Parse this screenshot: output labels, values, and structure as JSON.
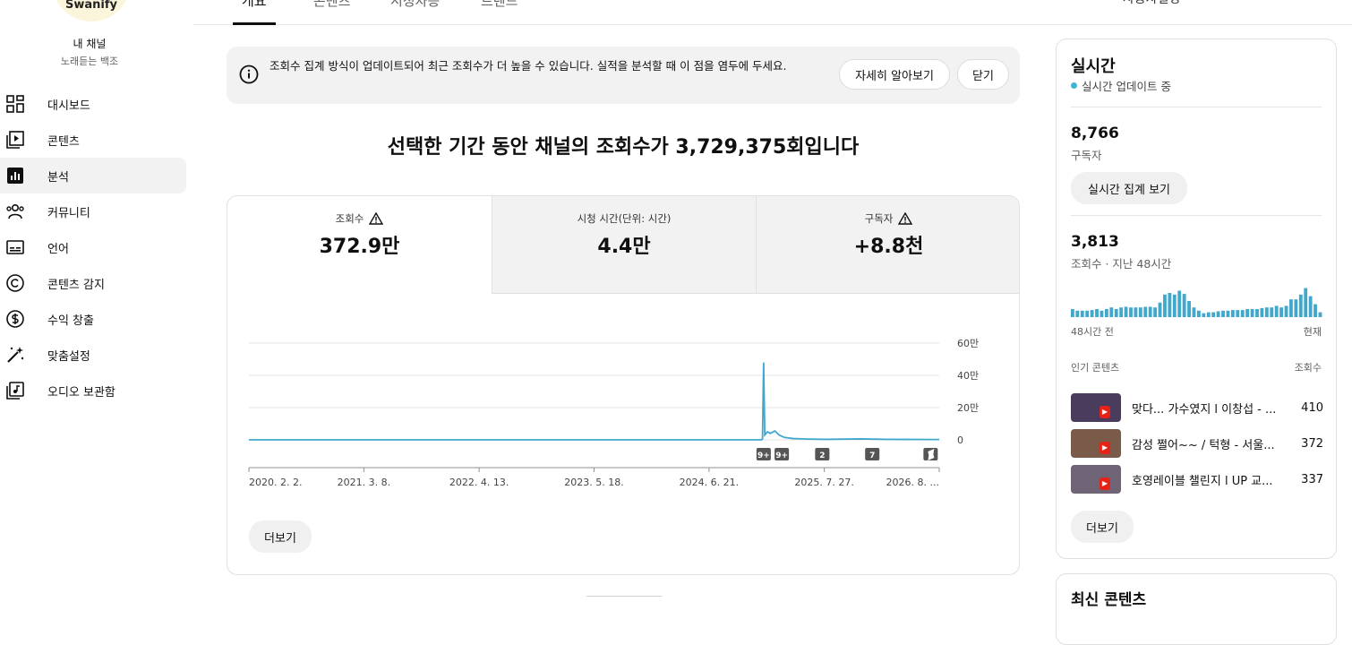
{
  "channel": {
    "logo_text": "Swanify",
    "name": "내 채널",
    "handle": "노래듣는 백조"
  },
  "nav": [
    {
      "label": "대시보드",
      "icon": "dashboard-icon",
      "active": false
    },
    {
      "label": "콘텐츠",
      "icon": "content-icon",
      "active": false
    },
    {
      "label": "분석",
      "icon": "analytics-icon",
      "active": true
    },
    {
      "label": "커뮤니티",
      "icon": "community-icon",
      "active": false
    },
    {
      "label": "언어",
      "icon": "subtitles-icon",
      "active": false
    },
    {
      "label": "콘텐츠 감지",
      "icon": "copyright-icon",
      "active": false
    },
    {
      "label": "수익 창출",
      "icon": "dollar-icon",
      "active": false
    },
    {
      "label": "맞춤설정",
      "icon": "magic-wand-icon",
      "active": false
    },
    {
      "label": "오디오 보관함",
      "icon": "audio-library-icon",
      "active": false
    }
  ],
  "tabs": [
    {
      "label": "개요",
      "active": true
    },
    {
      "label": "콘텐츠",
      "active": false
    },
    {
      "label": "시청자층",
      "active": false
    },
    {
      "label": "트렌드",
      "active": false
    }
  ],
  "tab_right_label": "사용자설정",
  "notice": {
    "text": "조회수 집계 방식이 업데이트되어 최근 조회수가 더 높을 수 있습니다. 실적을 분석할 때 이 점을 염두에 두세요.",
    "learn_more": "자세히 알아보기",
    "close": "닫기"
  },
  "headline": "선택한 기간 동안 채널의 조회수가 3,729,375회입니다",
  "metrics": [
    {
      "label": "조회수",
      "value": "372.9만",
      "warning": true,
      "active": true
    },
    {
      "label": "시청 시간(단위: 시간)",
      "value": "4.4만",
      "warning": false,
      "active": false
    },
    {
      "label": "구독자",
      "value": "+8.8천",
      "warning": true,
      "active": false
    }
  ],
  "chart_data": {
    "type": "line",
    "ylim": [
      0,
      600000
    ],
    "y_ticks": [
      {
        "value": 0,
        "label": "0"
      },
      {
        "value": 200000,
        "label": "20만"
      },
      {
        "value": 400000,
        "label": "40만"
      },
      {
        "value": 600000,
        "label": "60만"
      }
    ],
    "x_tick_labels": [
      "2020. 2. 2.",
      "2021. 3. 8.",
      "2022. 4. 13.",
      "2023. 5. 18.",
      "2024. 6. 21.",
      "2025. 7. 27.",
      "2026. 8. ..."
    ],
    "x_ticks_date": [
      "2020-02-02",
      "2021-03-08",
      "2022-04-13",
      "2023-05-18",
      "2024-06-21",
      "2025-07-27",
      "2026-08-31"
    ],
    "x_range": [
      "2020-02-02",
      "2026-08-31"
    ],
    "series": [
      {
        "color": "#41a8cc",
        "points": [
          [
            "2020-02-02",
            0
          ],
          [
            "2024-12-20",
            0
          ],
          [
            "2024-12-24",
            4000
          ],
          [
            "2024-12-28",
            480000
          ],
          [
            "2025-01-01",
            30000
          ],
          [
            "2025-01-10",
            50000
          ],
          [
            "2025-01-20",
            40000
          ],
          [
            "2025-02-05",
            55000
          ],
          [
            "2025-02-20",
            30000
          ],
          [
            "2025-03-10",
            15000
          ],
          [
            "2025-04-10",
            8000
          ],
          [
            "2025-06-01",
            5000
          ],
          [
            "2025-08-01",
            3000
          ],
          [
            "2025-12-01",
            6000
          ],
          [
            "2026-03-01",
            3000
          ],
          [
            "2026-08-31",
            2000
          ]
        ]
      }
    ],
    "markers": [
      {
        "date": "2024-12-28",
        "label": "9+"
      },
      {
        "date": "2025-03-01",
        "label": "9+"
      },
      {
        "date": "2025-07-20",
        "label": "2"
      },
      {
        "date": "2026-01-10",
        "label": "7"
      },
      {
        "date": "2026-08-01",
        "label": "shorts"
      }
    ]
  },
  "more_label": "더보기",
  "realtime": {
    "title": "실시간",
    "status": "실시간 업데이트 중",
    "subscribers_value": "8,766",
    "subscribers_label": "구독자",
    "realtime_button": "실시간 집계 보기",
    "views_value": "3,813",
    "views_label": "조회수 · 지난 48시간",
    "bars": [
      0.25,
      0.2,
      0.2,
      0.2,
      0.22,
      0.25,
      0.2,
      0.25,
      0.3,
      0.25,
      0.3,
      0.32,
      0.3,
      0.3,
      0.3,
      0.32,
      0.32,
      0.3,
      0.45,
      0.7,
      0.75,
      0.7,
      0.82,
      0.72,
      0.5,
      0.3,
      0.2,
      0.12,
      0.15,
      0.15,
      0.18,
      0.2,
      0.2,
      0.22,
      0.22,
      0.22,
      0.25,
      0.25,
      0.25,
      0.28,
      0.3,
      0.3,
      0.35,
      0.3,
      0.35,
      0.55,
      0.55,
      0.7,
      0.9,
      0.65,
      0.4,
      0.15
    ],
    "bars_start_label": "48시간 전",
    "bars_end_label": "현재",
    "top_header_left": "인기 콘텐츠",
    "top_header_right": "조회수",
    "top_content": [
      {
        "title": "맞다... 가수였지 l 이창섭 - ...",
        "views": "410",
        "thumb_color": "#4a3c5c"
      },
      {
        "title": "감성 쩔어~~ / 턱형 - 서울...",
        "views": "372",
        "thumb_color": "#7a5a48"
      },
      {
        "title": "호영레이블 챌린지 l UP 교...",
        "views": "337",
        "thumb_color": "#6f6476"
      }
    ],
    "more_label": "더보기"
  },
  "latest": {
    "title": "최신 콘텐츠"
  }
}
